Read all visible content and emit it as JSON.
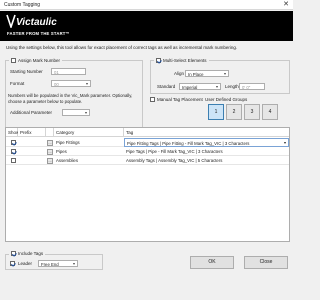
{
  "window": {
    "title": "Custom Tagging",
    "close_glyph": "✕"
  },
  "banner": {
    "logo_text": "Victaulic",
    "tagline": "FASTER FROM THE START™"
  },
  "intro_text": "Using the settings below, this tool allows for exact placement of correct tags as well as incremental mark numbering.",
  "assign_mark": {
    "label": "Assign Mark Number",
    "checked": false,
    "starting_number_label": "Starting Number",
    "starting_number_value": "01",
    "format_label": "Format",
    "format_value": "00",
    "note": "Numbers will be populated in the Vic_Mark parameter. Optionally, choose a parameter below to populate.",
    "additional_parameter_label": "Additional Parameter"
  },
  "multi_select": {
    "label": "Multi-Select Elements",
    "checked": true,
    "align_label": "Align",
    "align_value": "In Place",
    "standard_label": "Standard",
    "standard_value": "Imperial",
    "length_label": "Length",
    "length_value": "0' 0\""
  },
  "manual_tag_placement": {
    "label": "Manual Tag Placement",
    "checked": false
  },
  "user_defined_groups": {
    "label": "User Defined Groups",
    "buttons": [
      "1",
      "2",
      "3",
      "4"
    ],
    "active": "1"
  },
  "grid": {
    "columns": [
      "Show",
      "Prefix",
      "Category",
      "Tag"
    ],
    "rows": [
      {
        "show": true,
        "prefix": "",
        "category": "Pipe Fittings",
        "tag": "Pipe Fitting Tags | Pipe Fitting - Fill Mark Tag_VIC | 3 Characters"
      },
      {
        "show": true,
        "prefix": "",
        "category": "Pipes",
        "tag": "Pipe Tags | Pipe - Fill Mark Tag_VIC | 3 Characters"
      },
      {
        "show": false,
        "prefix": "",
        "category": "Assemblies",
        "tag": "Assembly Tags | Assembly Tag_VIC | 5 Characters"
      }
    ],
    "browse_glyph": "..."
  },
  "include_tags": {
    "label": "Include Tags",
    "checked": true
  },
  "leader": {
    "label": "Leader",
    "checked": true,
    "value": "Free End"
  },
  "buttons": {
    "ok": "OK",
    "close": "Close"
  },
  "colors": {
    "banner_bg": "#000000",
    "accent": "#1f4e9b",
    "selected_group": "#cce4f7"
  },
  "icons": {
    "dropdown": "chevron-down-icon",
    "close": "close-icon"
  }
}
